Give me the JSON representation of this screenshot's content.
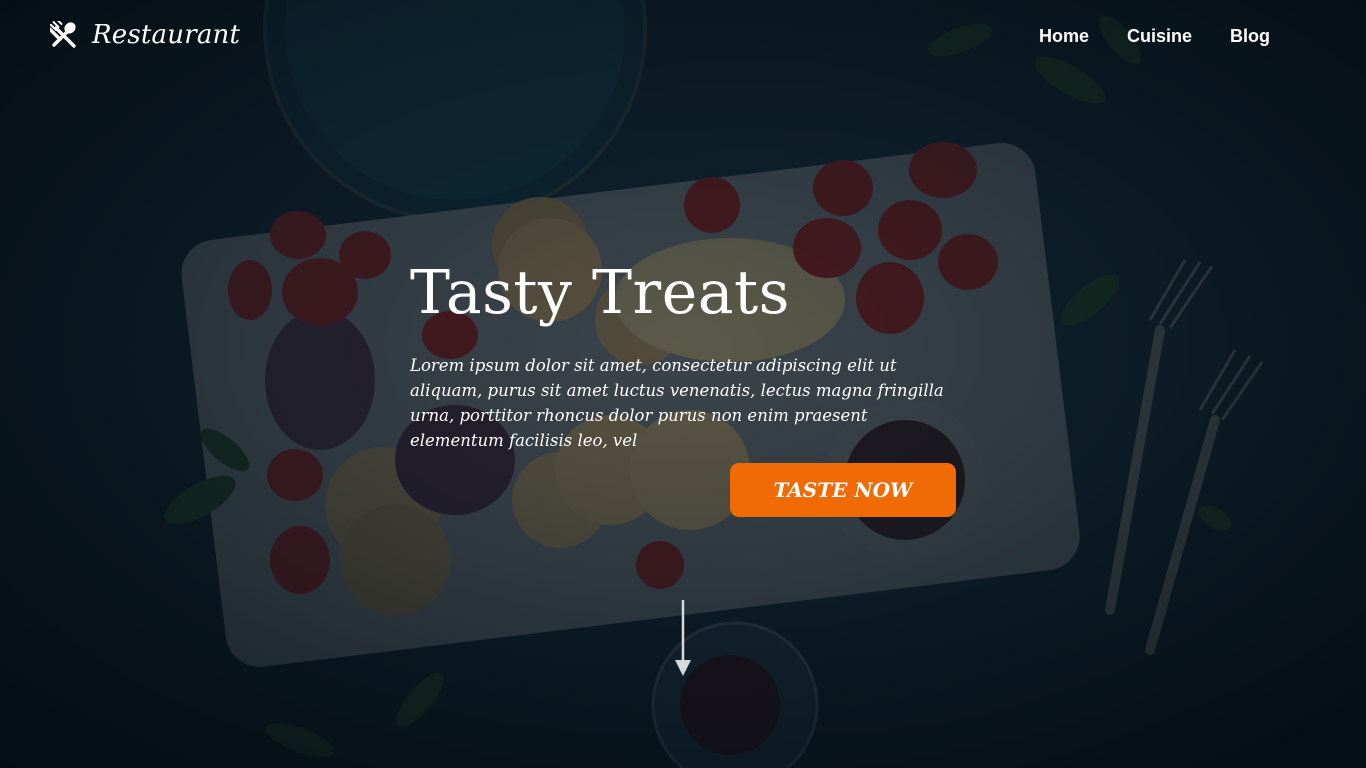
{
  "brand": {
    "icon": "fork-spoon-icon",
    "name": "Restaurant"
  },
  "nav": {
    "items": [
      {
        "label": "Home"
      },
      {
        "label": "Cuisine"
      },
      {
        "label": "Blog"
      }
    ]
  },
  "hero": {
    "title": "Tasty Treats",
    "text": "Lorem ipsum dolor sit amet, consectetur adipiscing elit ut aliquam, purus sit amet luctus venenatis, lectus magna fringilla urna, porttitor rhoncus dolor purus non enim praesent elementum facilisis leo, vel",
    "cta_label": "TASTE NOW",
    "scroll_icon": "arrow-down-icon"
  },
  "colors": {
    "accent": "#f06a06",
    "background": "#10242f",
    "text": "#ffffff"
  }
}
